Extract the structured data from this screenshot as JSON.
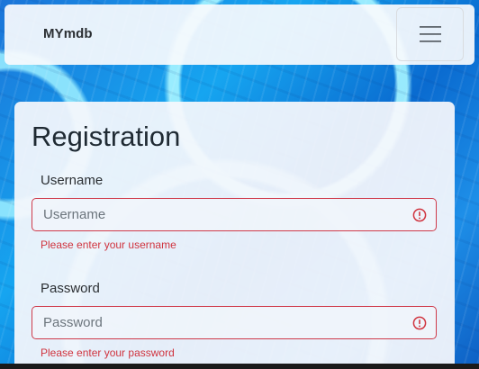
{
  "navbar": {
    "brand": "MYmdb",
    "toggler_icon": "hamburger-icon"
  },
  "form": {
    "title": "Registration",
    "username": {
      "label": "Username",
      "placeholder": "Username",
      "value": "",
      "error": "Please enter your username",
      "icon": "invalid-icon"
    },
    "password": {
      "label": "Password",
      "placeholder": "Password",
      "value": "",
      "error": "Please enter your password",
      "icon": "invalid-icon"
    }
  },
  "colors": {
    "error": "#d0343f",
    "invalid_border": "#cf3a4a"
  }
}
